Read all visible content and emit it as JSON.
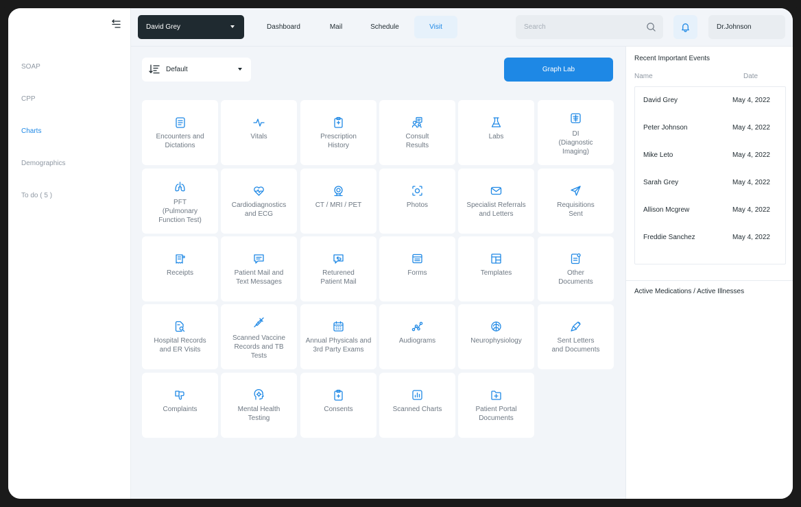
{
  "sidebar": {
    "items": [
      {
        "label": "SOAP",
        "active": false
      },
      {
        "label": "CPP",
        "active": false
      },
      {
        "label": "Charts",
        "active": true
      },
      {
        "label": "Demographics",
        "active": false
      },
      {
        "label": "To do ( 5 )",
        "active": false
      }
    ]
  },
  "topbar": {
    "patient": "David Grey",
    "tabs": [
      {
        "label": "Dashboard",
        "active": false
      },
      {
        "label": "Mail",
        "active": false
      },
      {
        "label": "Schedule",
        "active": false
      },
      {
        "label": "Visit",
        "active": true
      }
    ],
    "search_placeholder": "Search",
    "user": "Dr.Johnson"
  },
  "main": {
    "sort_label": "Default",
    "graph_button": "Graph Lab",
    "tiles": [
      {
        "label": "Encounters and\nDictations",
        "icon": "document-lines-icon"
      },
      {
        "label": "Vitals",
        "icon": "heartbeat-icon"
      },
      {
        "label": "Prescription\nHistory",
        "icon": "clipboard-icon"
      },
      {
        "label": "Consult\nResults",
        "icon": "consult-icon"
      },
      {
        "label": "Labs",
        "icon": "flask-icon"
      },
      {
        "label": "DI\n(Diagnostic\nImaging)",
        "icon": "xray-icon"
      },
      {
        "label": "PFT\n(Pulmonary\nFunction Test)",
        "icon": "lungs-icon"
      },
      {
        "label": "Cardiodiagnostics\nand ECG",
        "icon": "heart-pulse-icon"
      },
      {
        "label": "CT / MRI / PET",
        "icon": "scanner-icon"
      },
      {
        "label": "Photos",
        "icon": "camera-scan-icon"
      },
      {
        "label": "Specialist Referrals\nand Letters",
        "icon": "envelope-icon"
      },
      {
        "label": "Requisitions\nSent",
        "icon": "send-icon"
      },
      {
        "label": "Receipts",
        "icon": "receipt-icon"
      },
      {
        "label": "Patient Mail and\nText Messages",
        "icon": "message-icon"
      },
      {
        "label": "Returened\nPatient Mail",
        "icon": "return-mail-icon"
      },
      {
        "label": "Forms",
        "icon": "form-icon"
      },
      {
        "label": "Templates",
        "icon": "template-icon"
      },
      {
        "label": "Other\nDocuments",
        "icon": "document-badge-icon"
      },
      {
        "label": "Hospital Records\nand ER Visits",
        "icon": "document-search-icon"
      },
      {
        "label": "Scanned Vaccine\nRecords and TB\nTests",
        "icon": "syringe-icon"
      },
      {
        "label": "Annual Physicals and\n3rd Party Exams",
        "icon": "calendar-icon"
      },
      {
        "label": "Audiograms",
        "icon": "graph-nodes-icon"
      },
      {
        "label": "Neurophysiology",
        "icon": "brain-icon"
      },
      {
        "label": "Sent Letters\nand Documents",
        "icon": "sent-letter-icon"
      },
      {
        "label": "Complaints",
        "icon": "thumbs-down-icon"
      },
      {
        "label": "Mental Health\nTesting",
        "icon": "head-gear-icon"
      },
      {
        "label": "Consents",
        "icon": "clipboard-plus-icon"
      },
      {
        "label": "Scanned Charts",
        "icon": "bar-chart-icon"
      },
      {
        "label": "Patient Portal\nDocuments",
        "icon": "medical-folder-icon"
      }
    ]
  },
  "right": {
    "events_title": "Recent Important Events",
    "col_name": "Name",
    "col_date": "Date",
    "events": [
      {
        "name": "David Grey",
        "date": "May 4, 2022"
      },
      {
        "name": "Peter Johnson",
        "date": "May 4, 2022"
      },
      {
        "name": "Mike Leto",
        "date": "May 4, 2022"
      },
      {
        "name": "Sarah Grey",
        "date": "May 4, 2022"
      },
      {
        "name": "Allison Mcgrew",
        "date": "May 4, 2022"
      },
      {
        "name": "Freddie Sanchez",
        "date": "May 4, 2022"
      }
    ],
    "meds_title": "Active Medications / Active Illnesses"
  },
  "colors": {
    "accent": "#1e88e5",
    "dark": "#1f2a30",
    "bg": "#f2f5f9"
  }
}
